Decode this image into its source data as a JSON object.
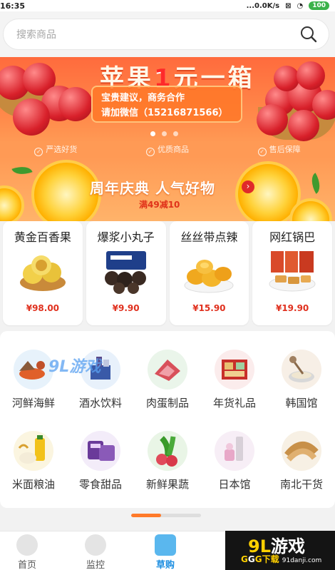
{
  "status": {
    "time": "16:35",
    "network": "...0.0K/s",
    "battery": "100"
  },
  "search": {
    "placeholder": "搜索商品"
  },
  "banner": {
    "title_pre": "苹果",
    "title_num": "1",
    "title_post": "元一箱",
    "line1": "宝贵建议，商务合作",
    "line2": "请加微信（15216871566）"
  },
  "guarantees": [
    "严选好货",
    "优质商品",
    "售后保障"
  ],
  "promo": {
    "title": "周年庆典 人气好物",
    "subtitle": "满49减10"
  },
  "products": [
    {
      "name": "黄金百香果",
      "price": "¥98.00"
    },
    {
      "name": "爆浆小丸子",
      "price": "¥9.90"
    },
    {
      "name": "丝丝带点辣",
      "price": "¥15.90"
    },
    {
      "name": "网红锅巴",
      "price": "¥19.90"
    }
  ],
  "categories": [
    {
      "label": "河鲜海鲜"
    },
    {
      "label": "酒水饮料"
    },
    {
      "label": "肉蛋制品"
    },
    {
      "label": "年货礼品"
    },
    {
      "label": "韩国馆"
    },
    {
      "label": "米面粮油"
    },
    {
      "label": "零食甜品"
    },
    {
      "label": "新鲜果蔬"
    },
    {
      "label": "日本馆"
    },
    {
      "label": "南北干货"
    }
  ],
  "watermark": {
    "text": "9L游戏"
  },
  "tabs": [
    {
      "label": "首页"
    },
    {
      "label": "监控"
    },
    {
      "label": "草购"
    }
  ],
  "corner": {
    "title_a": "9L",
    "title_b": "游戏",
    "sub_a": "G",
    "sub_b": "G",
    "sub_c": "G下载",
    "site": "91danji.com"
  },
  "colors": {
    "accent": "#ff7a2a",
    "price": "#e0301e",
    "tab_active": "#1b8de0"
  },
  "scroll_progress": 0.43
}
